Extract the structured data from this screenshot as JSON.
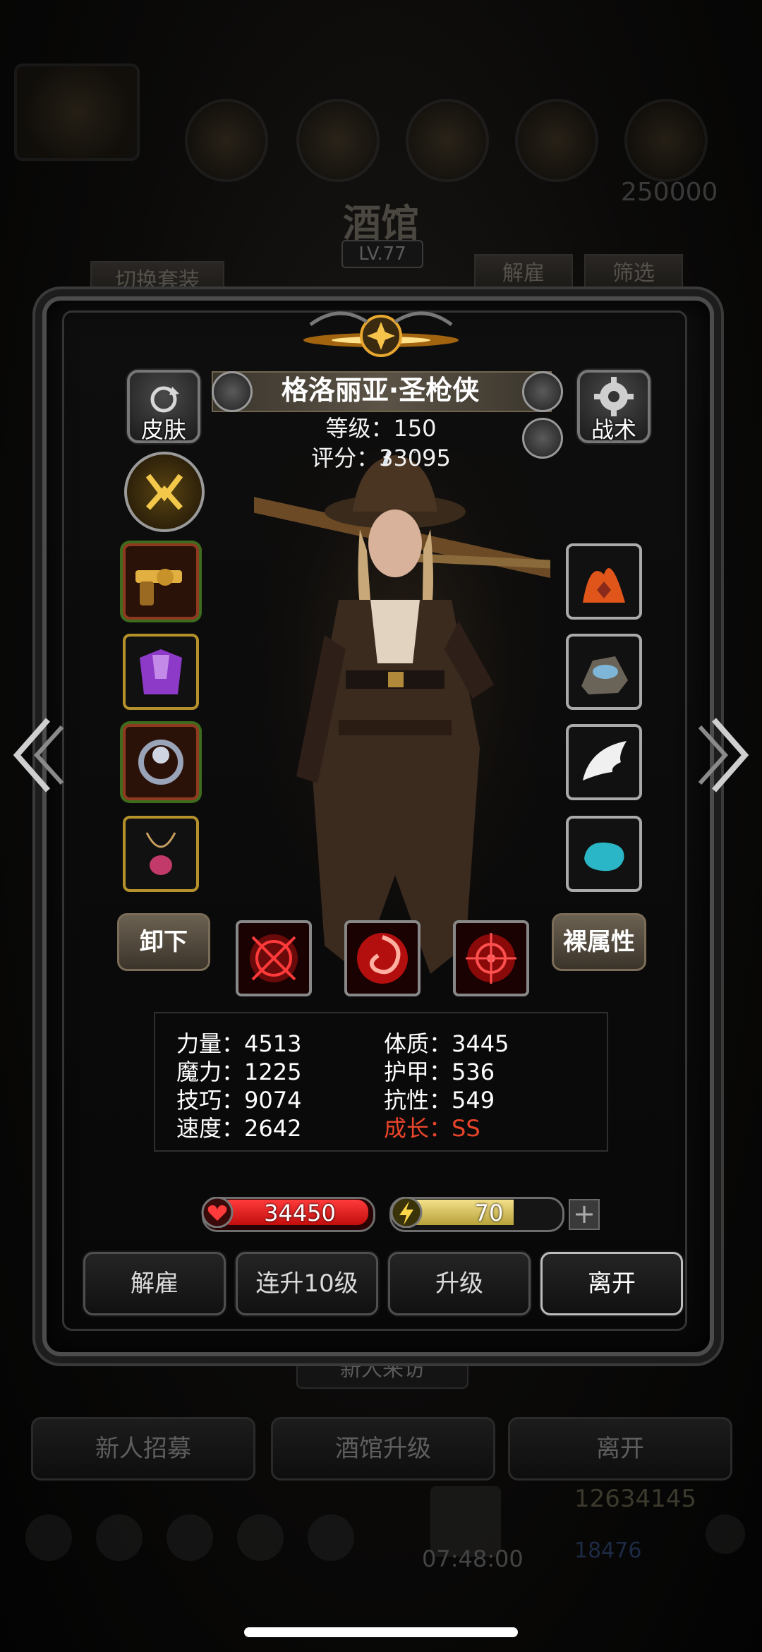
{
  "background": {
    "title": "酒馆",
    "level": "LV.77",
    "switch_set_label": "切换套装",
    "dismiss_label": "解雇",
    "filter_label": "筛选",
    "gold_top": "250000",
    "visitor_label": "新人来访",
    "bottom_buttons": [
      "新人招募",
      "酒馆升级",
      "离开"
    ],
    "gold_bottom": "12634145",
    "gems_bottom": "18476",
    "timer": "07:48:00"
  },
  "hero": {
    "name": "格洛丽亚·圣枪侠",
    "level_line": "等级：150",
    "score_line": "评分：33095",
    "skin_label": "皮肤",
    "tactics_label": "战术",
    "unequip_label": "卸下",
    "bare_attr_label": "裸属性"
  },
  "stats": {
    "left": [
      "力量：4513",
      "魔力：1225",
      "技巧：9074",
      "速度：2642"
    ],
    "right": [
      "体质：3445",
      "护甲：536",
      "抗性：549"
    ],
    "growth": "成长：SS"
  },
  "bars": {
    "hp": "34450",
    "energy": "70",
    "energy_fraction": 0.7,
    "plus": "+"
  },
  "actions": [
    "解雇",
    "连升10级",
    "升级",
    "离开"
  ],
  "icons": {
    "left_slots": [
      "golden-revolver-icon",
      "purple-armor-icon",
      "skull-ring-icon",
      "pendant-icon"
    ],
    "right_slots": [
      "flame-rune-icon",
      "ore-stone-icon",
      "white-wing-icon",
      "teal-gem-icon"
    ],
    "skills": [
      "crosshair-skill-icon",
      "swirl-skill-icon",
      "target-skill-icon"
    ]
  },
  "colors": {
    "accent_gold": "#b5912c",
    "hp_red": "#c20e0e",
    "energy_yellow": "#d4bf58",
    "growth_red": "#e8442a"
  }
}
